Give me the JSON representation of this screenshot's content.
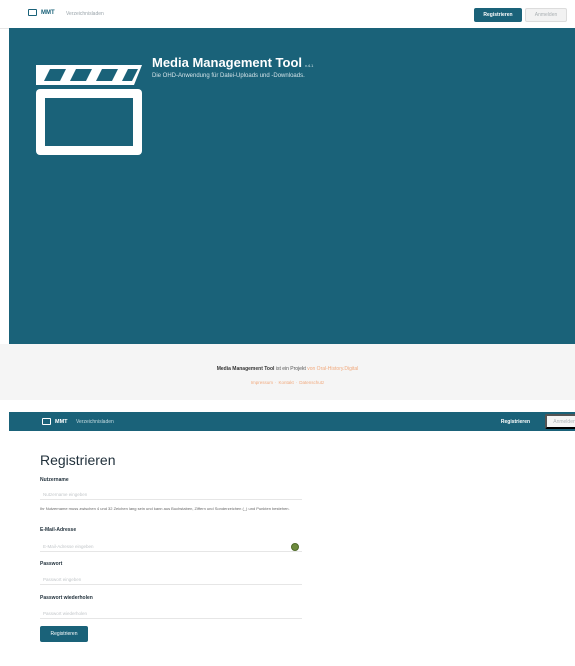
{
  "nav_top": {
    "brand": "MMT",
    "link": "Verzeichnisladen",
    "register_label": "Registrieren",
    "login_label": "Anmelden"
  },
  "hero": {
    "title": "Media Management Tool",
    "version": "v.4.1",
    "subtitle": "Die OHD-Anwendung für Datei-Uploads und -Downloads.",
    "icon": "clapperboard-icon"
  },
  "footer": {
    "product": "Media Management Tool",
    "text": "ist ein Projekt",
    "link_text": "von Oral-History.Digital",
    "links": [
      "Impressum",
      "Kontakt",
      "Datenschutz"
    ]
  },
  "nav_form": {
    "brand": "MMT",
    "link": "Verzeichnisladen",
    "register_label": "Registrieren",
    "login_label": "Anmelden"
  },
  "form": {
    "title": "Registrieren",
    "username_label": "Nutzername",
    "username_placeholder": "Nutzername eingeben",
    "username_hint": "Ihr Nutzername muss zwischen 4 und 32 Zeichen lang sein und kann aus Buchstaben, Ziffern und Sonderzeichen (_) und Punkten bestehen.",
    "email_label": "E-Mail-Adresse",
    "email_placeholder": "E-Mail-Adresse eingeben",
    "password_label": "Passwort",
    "password_placeholder": "Passwort eingeben",
    "password_repeat_label": "Passwort wiederholen",
    "password_repeat_placeholder": "Passwort wiederholen",
    "submit_label": "Registrieren"
  },
  "colors": {
    "brand": "#1a6279",
    "footer_link": "#f1a97d"
  }
}
